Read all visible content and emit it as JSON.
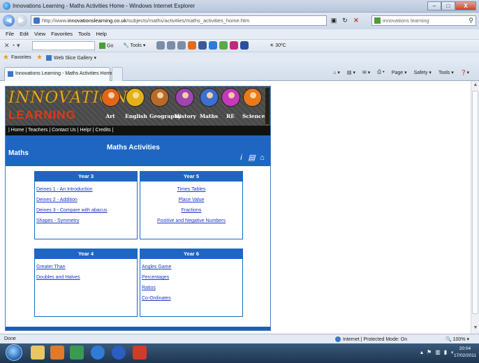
{
  "window": {
    "title": "Innovations Learning - Maths Activities Home - Windows Internet Explorer",
    "buttons": {
      "minimize": "–",
      "maximize": "□",
      "close": "X"
    }
  },
  "address": {
    "url_prefix": "http://www.",
    "url_domain": "innovationslearning.co.uk",
    "url_path": "/subjects/maths/activities/maths_activities_home.htm",
    "search_text": "innovations learning"
  },
  "menu": [
    "File",
    "Edit",
    "View",
    "Favorites",
    "Tools",
    "Help"
  ],
  "toolbar": {
    "go": "Go",
    "tools": "Tools",
    "temperature": "30ºC"
  },
  "favorites": {
    "label": "Favorites",
    "web_slice": "Web Slice Gallery ▾"
  },
  "tab": {
    "label": "Innovations Learning - Maths Activities Home"
  },
  "command_bar": [
    "Page ▾",
    "Safety ▾",
    "Tools ▾"
  ],
  "site": {
    "logo_top": "INNOVATIONS",
    "logo_bottom": "LEARNING",
    "subjects": [
      {
        "label": "Art",
        "color": "#e0661c"
      },
      {
        "label": "English",
        "color": "#e3b21a"
      },
      {
        "label": "Geography",
        "color": "#b86a2a"
      },
      {
        "label": "History",
        "color": "#a045b0"
      },
      {
        "label": "Maths",
        "color": "#3c6fd0"
      },
      {
        "label": "RE",
        "color": "#c43ab8"
      },
      {
        "label": "Science",
        "color": "#e87a1a"
      }
    ],
    "nav_text": "| Home | Teachers | Contact Us | Help! | Credits |",
    "section": "Maths",
    "page_title": "Maths Activities",
    "boxes": [
      {
        "header": "Year 3",
        "links": [
          "Deines 1 - An Introduction",
          "Deines 2 - Addition",
          "Deines 3 - Compare with abacus",
          "Shapes - Symmetry"
        ]
      },
      {
        "header": "Year 5",
        "links": [
          "Times Tables",
          "Place Value",
          "Fractions",
          "Positive and Negative Numbers"
        ]
      },
      {
        "header": "Year 4",
        "links": [
          "Greater Than",
          "Doubles and Halves"
        ]
      },
      {
        "header": "Year 6",
        "links": [
          "Angles Game",
          "Percentages",
          "Ratios",
          "Co-Ordinates"
        ]
      }
    ]
  },
  "status": {
    "done": "Done",
    "zone": "Internet | Protected Mode: On",
    "zoom": "100%"
  },
  "clock": {
    "time": "20:04",
    "date": "17/02/2011"
  }
}
